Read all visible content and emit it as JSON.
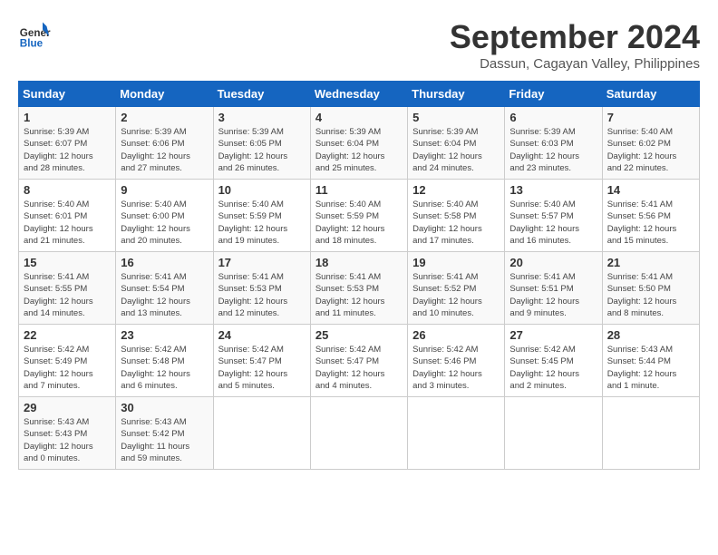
{
  "header": {
    "logo_line1": "General",
    "logo_line2": "Blue",
    "month": "September 2024",
    "location": "Dassun, Cagayan Valley, Philippines"
  },
  "columns": [
    "Sunday",
    "Monday",
    "Tuesday",
    "Wednesday",
    "Thursday",
    "Friday",
    "Saturday"
  ],
  "weeks": [
    [
      {
        "day": "1",
        "info": "Sunrise: 5:39 AM\nSunset: 6:07 PM\nDaylight: 12 hours\nand 28 minutes."
      },
      {
        "day": "2",
        "info": "Sunrise: 5:39 AM\nSunset: 6:06 PM\nDaylight: 12 hours\nand 27 minutes."
      },
      {
        "day": "3",
        "info": "Sunrise: 5:39 AM\nSunset: 6:05 PM\nDaylight: 12 hours\nand 26 minutes."
      },
      {
        "day": "4",
        "info": "Sunrise: 5:39 AM\nSunset: 6:04 PM\nDaylight: 12 hours\nand 25 minutes."
      },
      {
        "day": "5",
        "info": "Sunrise: 5:39 AM\nSunset: 6:04 PM\nDaylight: 12 hours\nand 24 minutes."
      },
      {
        "day": "6",
        "info": "Sunrise: 5:39 AM\nSunset: 6:03 PM\nDaylight: 12 hours\nand 23 minutes."
      },
      {
        "day": "7",
        "info": "Sunrise: 5:40 AM\nSunset: 6:02 PM\nDaylight: 12 hours\nand 22 minutes."
      }
    ],
    [
      {
        "day": "8",
        "info": "Sunrise: 5:40 AM\nSunset: 6:01 PM\nDaylight: 12 hours\nand 21 minutes."
      },
      {
        "day": "9",
        "info": "Sunrise: 5:40 AM\nSunset: 6:00 PM\nDaylight: 12 hours\nand 20 minutes."
      },
      {
        "day": "10",
        "info": "Sunrise: 5:40 AM\nSunset: 5:59 PM\nDaylight: 12 hours\nand 19 minutes."
      },
      {
        "day": "11",
        "info": "Sunrise: 5:40 AM\nSunset: 5:59 PM\nDaylight: 12 hours\nand 18 minutes."
      },
      {
        "day": "12",
        "info": "Sunrise: 5:40 AM\nSunset: 5:58 PM\nDaylight: 12 hours\nand 17 minutes."
      },
      {
        "day": "13",
        "info": "Sunrise: 5:40 AM\nSunset: 5:57 PM\nDaylight: 12 hours\nand 16 minutes."
      },
      {
        "day": "14",
        "info": "Sunrise: 5:41 AM\nSunset: 5:56 PM\nDaylight: 12 hours\nand 15 minutes."
      }
    ],
    [
      {
        "day": "15",
        "info": "Sunrise: 5:41 AM\nSunset: 5:55 PM\nDaylight: 12 hours\nand 14 minutes."
      },
      {
        "day": "16",
        "info": "Sunrise: 5:41 AM\nSunset: 5:54 PM\nDaylight: 12 hours\nand 13 minutes."
      },
      {
        "day": "17",
        "info": "Sunrise: 5:41 AM\nSunset: 5:53 PM\nDaylight: 12 hours\nand 12 minutes."
      },
      {
        "day": "18",
        "info": "Sunrise: 5:41 AM\nSunset: 5:53 PM\nDaylight: 12 hours\nand 11 minutes."
      },
      {
        "day": "19",
        "info": "Sunrise: 5:41 AM\nSunset: 5:52 PM\nDaylight: 12 hours\nand 10 minutes."
      },
      {
        "day": "20",
        "info": "Sunrise: 5:41 AM\nSunset: 5:51 PM\nDaylight: 12 hours\nand 9 minutes."
      },
      {
        "day": "21",
        "info": "Sunrise: 5:41 AM\nSunset: 5:50 PM\nDaylight: 12 hours\nand 8 minutes."
      }
    ],
    [
      {
        "day": "22",
        "info": "Sunrise: 5:42 AM\nSunset: 5:49 PM\nDaylight: 12 hours\nand 7 minutes."
      },
      {
        "day": "23",
        "info": "Sunrise: 5:42 AM\nSunset: 5:48 PM\nDaylight: 12 hours\nand 6 minutes."
      },
      {
        "day": "24",
        "info": "Sunrise: 5:42 AM\nSunset: 5:47 PM\nDaylight: 12 hours\nand 5 minutes."
      },
      {
        "day": "25",
        "info": "Sunrise: 5:42 AM\nSunset: 5:47 PM\nDaylight: 12 hours\nand 4 minutes."
      },
      {
        "day": "26",
        "info": "Sunrise: 5:42 AM\nSunset: 5:46 PM\nDaylight: 12 hours\nand 3 minutes."
      },
      {
        "day": "27",
        "info": "Sunrise: 5:42 AM\nSunset: 5:45 PM\nDaylight: 12 hours\nand 2 minutes."
      },
      {
        "day": "28",
        "info": "Sunrise: 5:43 AM\nSunset: 5:44 PM\nDaylight: 12 hours\nand 1 minute."
      }
    ],
    [
      {
        "day": "29",
        "info": "Sunrise: 5:43 AM\nSunset: 5:43 PM\nDaylight: 12 hours\nand 0 minutes."
      },
      {
        "day": "30",
        "info": "Sunrise: 5:43 AM\nSunset: 5:42 PM\nDaylight: 11 hours\nand 59 minutes."
      },
      {
        "day": "",
        "info": ""
      },
      {
        "day": "",
        "info": ""
      },
      {
        "day": "",
        "info": ""
      },
      {
        "day": "",
        "info": ""
      },
      {
        "day": "",
        "info": ""
      }
    ]
  ]
}
